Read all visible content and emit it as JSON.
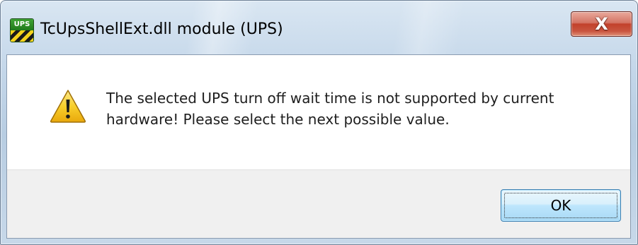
{
  "window": {
    "title": "TcUpsShellExt.dll module (UPS)"
  },
  "icons": {
    "app": "ups-app-icon",
    "app_icon_text": "UPS",
    "close": "close-icon",
    "close_glyph": "X",
    "warning": "warning-icon"
  },
  "dialog": {
    "message_line1": "The selected UPS turn off wait time is not supported by current",
    "message_line2": "hardware! Please select the next possible value.",
    "ok_label": "OK"
  },
  "colors": {
    "close_button": "#c2412b",
    "warning_yellow": "#f6c61a",
    "ok_button_border": "#3c7fb1"
  }
}
